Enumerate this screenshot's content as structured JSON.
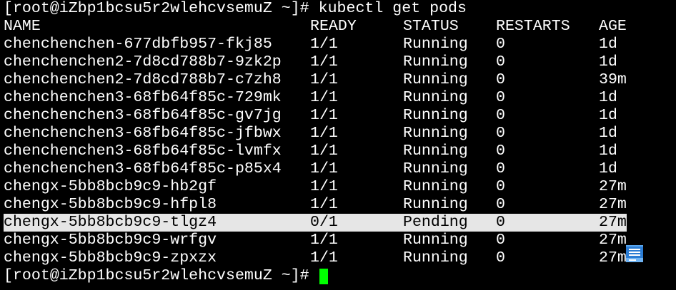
{
  "terminal": {
    "command_line": {
      "prompt": "[root@iZbp1bcsu5r2wlehcvsemuZ ~]#",
      "command": "kubectl get pods"
    },
    "input_line": {
      "prompt": "[root@iZbp1bcsu5r2wlehcvsemuZ ~]#"
    }
  },
  "pods_table": {
    "headers": {
      "name": "NAME",
      "ready": "READY",
      "status": "STATUS",
      "restarts": "RESTARTS",
      "age": "AGE"
    },
    "rows": [
      {
        "name": "chenchenchen-677dbfb957-fkj85",
        "ready": "1/1",
        "status": "Running",
        "restarts": "0",
        "age": "1d"
      },
      {
        "name": "chenchenchen2-7d8cd788b7-9zk2p",
        "ready": "1/1",
        "status": "Running",
        "restarts": "0",
        "age": "1d"
      },
      {
        "name": "chenchenchen2-7d8cd788b7-c7zh8",
        "ready": "1/1",
        "status": "Running",
        "restarts": "0",
        "age": "39m"
      },
      {
        "name": "chenchenchen3-68fb64f85c-729mk",
        "ready": "1/1",
        "status": "Running",
        "restarts": "0",
        "age": "1d"
      },
      {
        "name": "chenchenchen3-68fb64f85c-gv7jg",
        "ready": "1/1",
        "status": "Running",
        "restarts": "0",
        "age": "1d"
      },
      {
        "name": "chenchenchen3-68fb64f85c-jfbwx",
        "ready": "1/1",
        "status": "Running",
        "restarts": "0",
        "age": "1d"
      },
      {
        "name": "chenchenchen3-68fb64f85c-lvmfx",
        "ready": "1/1",
        "status": "Running",
        "restarts": "0",
        "age": "1d"
      },
      {
        "name": "chenchenchen3-68fb64f85c-p85x4",
        "ready": "1/1",
        "status": "Running",
        "restarts": "0",
        "age": "1d"
      },
      {
        "name": "chengx-5bb8bcb9c9-hb2gf",
        "ready": "1/1",
        "status": "Running",
        "restarts": "0",
        "age": "27m"
      },
      {
        "name": "chengx-5bb8bcb9c9-hfpl8",
        "ready": "1/1",
        "status": "Running",
        "restarts": "0",
        "age": "27m"
      },
      {
        "name": "chengx-5bb8bcb9c9-tlgz4",
        "ready": "0/1",
        "status": "Pending",
        "restarts": "0",
        "age": "27m",
        "selected": true
      },
      {
        "name": "chengx-5bb8bcb9c9-wrfgv",
        "ready": "1/1",
        "status": "Running",
        "restarts": "0",
        "age": "27m"
      },
      {
        "name": "chengx-5bb8bcb9c9-zpxzx",
        "ready": "1/1",
        "status": "Running",
        "restarts": "0",
        "age": "27m"
      }
    ]
  },
  "icons": {
    "floating_widget": "document-icon"
  },
  "colors": {
    "background": "#000000",
    "text": "#ffffff",
    "selection_background": "#e6e6e6",
    "selection_text": "#000000",
    "cursor": "#00ff00",
    "widget": "#2b7cd3"
  }
}
